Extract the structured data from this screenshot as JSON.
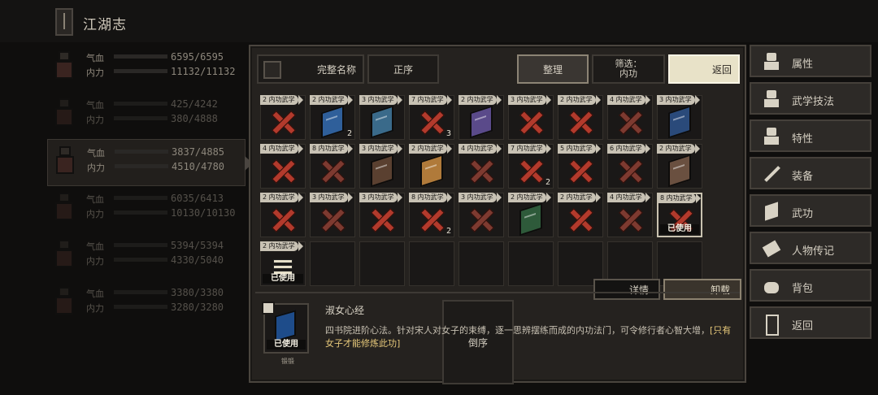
{
  "header": {
    "title": "江湖志"
  },
  "party": [
    {
      "hp_label": "气血",
      "hp_value": "6595/6595",
      "hp_fill": 1.0,
      "mp_label": "内力",
      "mp_value": "11132/11132",
      "mp_fill": 1.0,
      "selected": false,
      "dim": false
    },
    {
      "hp_label": "气血",
      "hp_value": "425/4242",
      "hp_fill": 0.1,
      "mp_label": "内力",
      "mp_value": "380/4888",
      "mp_fill": 0.08,
      "selected": false,
      "dim": true
    },
    {
      "hp_label": "气血",
      "hp_value": "3837/4885",
      "hp_fill": 0.79,
      "mp_label": "内力",
      "mp_value": "4510/4780",
      "mp_fill": 0.94,
      "selected": true,
      "dim": false
    },
    {
      "hp_label": "气血",
      "hp_value": "6035/6413",
      "hp_fill": 0.94,
      "mp_label": "内力",
      "mp_value": "10130/10130",
      "mp_fill": 1.0,
      "selected": false,
      "dim": true
    },
    {
      "hp_label": "气血",
      "hp_value": "5394/5394",
      "hp_fill": 1.0,
      "mp_label": "内力",
      "mp_value": "4330/5040",
      "mp_fill": 0.86,
      "selected": false,
      "dim": true
    },
    {
      "hp_label": "气血",
      "hp_value": "3380/3380",
      "hp_fill": 1.0,
      "mp_label": "内力",
      "mp_value": "3280/3280",
      "mp_fill": 1.0,
      "selected": false,
      "dim": true
    }
  ],
  "toolbar": {
    "fullname_label": "完整名称",
    "asc_label": "正序",
    "desc_label": "倒序",
    "sort_label": "整理",
    "filter_label": "筛选：",
    "filter_value": "内功",
    "back_label": "返回"
  },
  "inventory": [
    {
      "tag": "2 内功武学",
      "kind": "cross",
      "count": ""
    },
    {
      "tag": "2 内功武学",
      "kind": "book",
      "color": "#2f5f9a",
      "count": "2"
    },
    {
      "tag": "3 内功武学",
      "kind": "book",
      "color": "#3a6a8a",
      "count": ""
    },
    {
      "tag": "7 内功武学",
      "kind": "cross",
      "count": "3"
    },
    {
      "tag": "2 内功武学",
      "kind": "book",
      "color": "#5a4a8a",
      "count": ""
    },
    {
      "tag": "3 内功武学",
      "kind": "cross",
      "count": ""
    },
    {
      "tag": "2 内功武学",
      "kind": "cross",
      "count": ""
    },
    {
      "tag": "4 内功武学",
      "kind": "cross",
      "count": ""
    },
    {
      "tag": "3 内功武学",
      "kind": "book",
      "color": "#2a4a7a",
      "count": ""
    },
    {
      "tag": "4 内功武学",
      "kind": "cross",
      "count": ""
    },
    {
      "tag": "8 内功武学",
      "kind": "cross",
      "count": ""
    },
    {
      "tag": "3 内功武学",
      "kind": "book",
      "color": "#5a4030",
      "count": ""
    },
    {
      "tag": "2 内功武学",
      "kind": "book",
      "color": "#b07a3a",
      "count": ""
    },
    {
      "tag": "4 内功武学",
      "kind": "cross",
      "count": ""
    },
    {
      "tag": "7 内功武学",
      "kind": "cross",
      "count": "2"
    },
    {
      "tag": "5 内功武学",
      "kind": "cross",
      "count": ""
    },
    {
      "tag": "6 内功武学",
      "kind": "cross",
      "count": ""
    },
    {
      "tag": "2 内功武学",
      "kind": "book",
      "color": "#6a5040",
      "count": ""
    },
    {
      "tag": "2 内功武学",
      "kind": "cross",
      "count": ""
    },
    {
      "tag": "3 内功武学",
      "kind": "cross",
      "count": ""
    },
    {
      "tag": "3 内功武学",
      "kind": "cross",
      "count": ""
    },
    {
      "tag": "8 内功武学",
      "kind": "cross",
      "count": "2"
    },
    {
      "tag": "3 内功武学",
      "kind": "cross",
      "count": ""
    },
    {
      "tag": "2 内功武学",
      "kind": "book",
      "color": "#2e5a3a",
      "count": ""
    },
    {
      "tag": "2 内功武学",
      "kind": "cross",
      "count": ""
    },
    {
      "tag": "4 内功武学",
      "kind": "cross",
      "count": ""
    },
    {
      "tag": "8 内功武学",
      "kind": "cross-used",
      "count": "",
      "used": "已使用"
    },
    {
      "tag": "2 内功武学",
      "kind": "stack-used",
      "count": "",
      "used": "已使用"
    },
    {
      "kind": "empty"
    },
    {
      "kind": "empty"
    },
    {
      "kind": "empty"
    },
    {
      "kind": "empty"
    },
    {
      "kind": "empty"
    },
    {
      "kind": "empty"
    },
    {
      "kind": "empty"
    },
    {
      "kind": "empty"
    }
  ],
  "actions": {
    "detail_label": "详情",
    "unequip_label": "卸载"
  },
  "detail": {
    "name": "淑女心经",
    "used": "已使用",
    "caption": "锻锻",
    "text": "四书院进阶心法。针对宋人对女子的束缚，逐一思辨摆练而成的内功法门，可令修行者心智大增，",
    "highlight": "[只有女子才能修炼此功]"
  },
  "menu": [
    {
      "label": "属性",
      "icon": "person-icon"
    },
    {
      "label": "武学技法",
      "icon": "martial-icon"
    },
    {
      "label": "特性",
      "icon": "trait-icon"
    },
    {
      "label": "装备",
      "icon": "sword-icon"
    },
    {
      "label": "武功",
      "icon": "book-icon"
    },
    {
      "label": "人物传记",
      "icon": "scroll-icon"
    },
    {
      "label": "背包",
      "icon": "bag-icon"
    },
    {
      "label": "返回",
      "icon": "door-icon"
    }
  ],
  "colors": {
    "cross_red": "#b23a2c",
    "accent_cream": "#e8e2c8",
    "highlight_gold": "#e6c87a"
  }
}
